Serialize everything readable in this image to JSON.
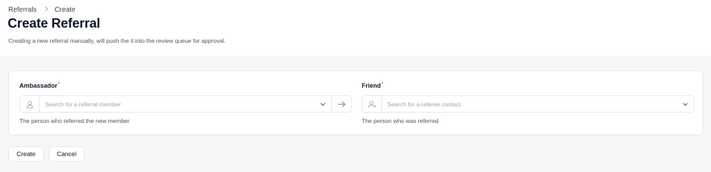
{
  "breadcrumb": {
    "parent": "Referrals",
    "current": "Create"
  },
  "page": {
    "title": "Create Referral",
    "description": "Creating a new referral manually, will push the it into the review queue for approval."
  },
  "form": {
    "ambassador": {
      "label": "Ambassador",
      "required_mark": "*",
      "placeholder": "Search for a referral member",
      "value": "",
      "hint": "The person who referred the new member",
      "icon": "user-icon"
    },
    "friend": {
      "label": "Friend",
      "required_mark": "*",
      "placeholder": "Search for a referee contact",
      "value": "",
      "hint": "The person who was referred",
      "icon": "user-plus-icon"
    }
  },
  "actions": {
    "create_label": "Create",
    "cancel_label": "Cancel"
  },
  "colors": {
    "background": "#f6f6f7",
    "card": "#ffffff",
    "border": "#e5e7eb",
    "text": "#111827",
    "muted": "#9ca3af"
  }
}
